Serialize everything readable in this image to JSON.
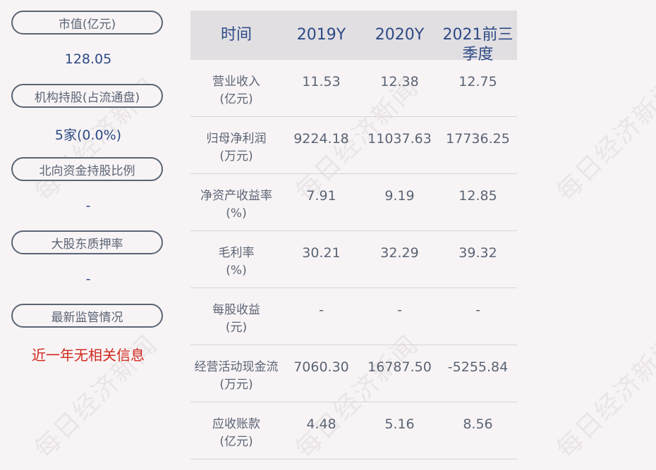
{
  "left_panel": [
    {
      "label": "市值(亿元)",
      "value": "128.05"
    },
    {
      "label": "机构持股(占流通盘)",
      "value": "5家(0.0%)"
    },
    {
      "label": "北向资金持股比例",
      "value": "-"
    },
    {
      "label": "大股东质押率",
      "value": "-"
    },
    {
      "label": "最新监管情况",
      "value": "近一年无相关信息"
    }
  ],
  "table": {
    "headers": [
      "时间",
      "2019Y",
      "2020Y",
      "2021前三季度"
    ],
    "rows": [
      {
        "label": [
          "营业收入",
          "(亿元)"
        ],
        "values": [
          "11.53",
          "12.38",
          "12.75"
        ]
      },
      {
        "label": [
          "归母净利润",
          "(万元)"
        ],
        "values": [
          "9224.18",
          "11037.63",
          "17736.25"
        ]
      },
      {
        "label": [
          "净资产收益率",
          "(%)"
        ],
        "values": [
          "7.91",
          "9.19",
          "12.85"
        ]
      },
      {
        "label": [
          "毛利率",
          "(%)"
        ],
        "values": [
          "30.21",
          "32.29",
          "39.32"
        ]
      },
      {
        "label": [
          "每股收益",
          "(元)"
        ],
        "values": [
          "-",
          "-",
          "-"
        ]
      },
      {
        "label": [
          "经营活动现金流",
          "(万元)"
        ],
        "values": [
          "7060.30",
          "16787.50",
          "-5255.84"
        ]
      },
      {
        "label": [
          "应收账款",
          "(亿元)"
        ],
        "values": [
          "4.48",
          "5.16",
          "8.56"
        ]
      }
    ]
  },
  "watermark": "每日经济新闻",
  "colors": {
    "accent": "#2c4a86",
    "label": "#5a6475",
    "alert": "#d0281e",
    "header_bg": "#e2dfe2",
    "background": "#f8f4f5"
  }
}
